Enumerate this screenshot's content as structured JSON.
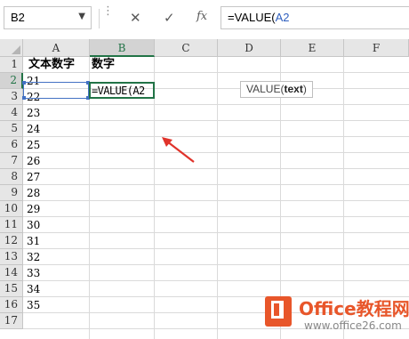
{
  "formula_bar": {
    "name_box": "B2",
    "name_box_arrow": "▼",
    "cancel_icon": "✕",
    "enter_icon": "✓",
    "function_icon": "fx",
    "formula_prefix": "=VALUE(",
    "formula_ref": "A2"
  },
  "columns": [
    "A",
    "B",
    "C",
    "D",
    "E",
    "F"
  ],
  "rows": [
    "1",
    "2",
    "3",
    "4",
    "5",
    "6",
    "7",
    "8",
    "9",
    "10",
    "11",
    "12",
    "13",
    "14",
    "15",
    "16",
    "17"
  ],
  "cells": {
    "a1": "文本数字",
    "b1": "数字",
    "b2": "=VALUE(A2",
    "a_values": [
      "21",
      "22",
      "23",
      "24",
      "25",
      "26",
      "27",
      "28",
      "29",
      "30",
      "31",
      "32",
      "33",
      "34",
      "35"
    ]
  },
  "tooltip": {
    "fn": "VALUE(",
    "arg": "text",
    "close": ")"
  },
  "watermark": {
    "title": "Office教程网",
    "url": "www.office26.com"
  },
  "colors": {
    "excel_green": "#217346",
    "ref_blue": "#4472c4",
    "arrow_red": "#e0332b",
    "logo_orange": "#e8562a"
  }
}
